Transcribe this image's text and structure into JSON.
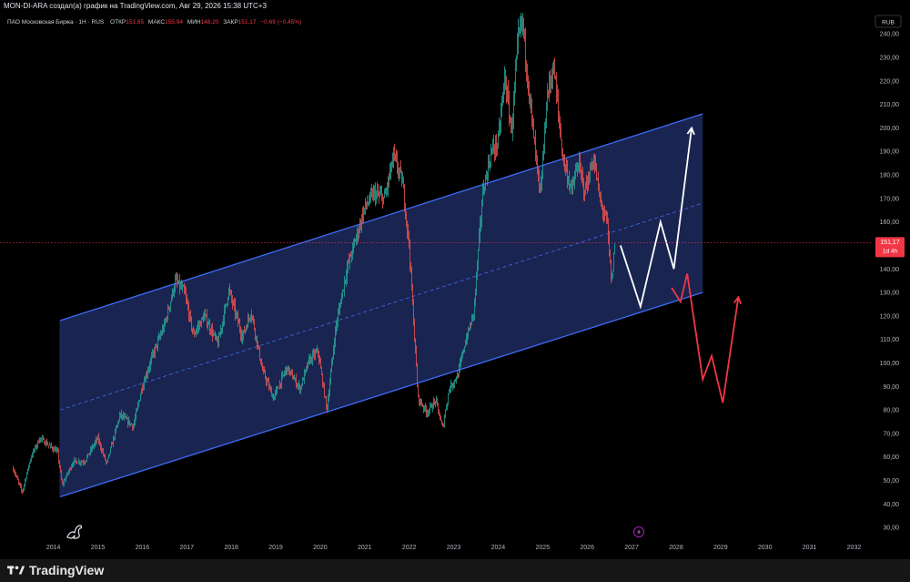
{
  "header": {
    "attribution": "MON-DI-ARA создал(а) график на TradingView.com, Авг 29, 2026 15:38 UTC+3"
  },
  "legend": {
    "symbol": "ПАО Московская Биржа · 1Н · RUS",
    "open_label": "ОТКР",
    "open_value": "151,85",
    "high_label": "МАКС",
    "high_value": "155,94",
    "low_label": "МИН",
    "low_value": "148,20",
    "close_label": "ЗАКР",
    "close_value": "151,17",
    "change": "−0,69 (−0,45%)"
  },
  "currency": "RUB",
  "price_label": {
    "value": "151,17",
    "countdown": "1d 4h"
  },
  "footer": {
    "brand": "TradingView"
  },
  "colors": {
    "background": "#000000",
    "channel_fill": "#1e2a5e",
    "channel_line": "#3d6cf7",
    "up_candle": "#26a69a",
    "down_candle": "#ef5350",
    "projection_white": "#ffffff",
    "projection_red": "#f23645",
    "price_line": "#f23645"
  },
  "chart_data": {
    "type": "candlestick",
    "y_axis": {
      "ticks": [
        30,
        40,
        50,
        60,
        70,
        80,
        90,
        100,
        110,
        120,
        130,
        140,
        150,
        160,
        170,
        180,
        190,
        200,
        210,
        220,
        230,
        240
      ],
      "tick_labels": [
        "30,00",
        "40,00",
        "50,00",
        "60,00",
        "70,00",
        "80,00",
        "90,00",
        "100,00",
        "110,00",
        "120,00",
        "130,00",
        "140,00",
        "150,00",
        "160,00",
        "170,00",
        "180,00",
        "190,00",
        "200,00",
        "210,00",
        "220,00",
        "230,00",
        "240,00"
      ],
      "range": [
        25,
        249
      ]
    },
    "x_axis": {
      "ticks": [
        2014,
        2015,
        2016,
        2017,
        2018,
        2019,
        2020,
        2021,
        2022,
        2023,
        2024,
        2025,
        2026,
        2027,
        2028,
        2029,
        2030,
        2031,
        2032
      ],
      "tick_labels": [
        "2014",
        "2015",
        "2016",
        "2017",
        "2018",
        "2019",
        "2020",
        "2021",
        "2022",
        "2023",
        "2024",
        "2025",
        "2026",
        "2027",
        "2028",
        "2029",
        "2030",
        "2031",
        "2032"
      ],
      "range": [
        2012.8,
        2032.4
      ]
    },
    "price_path": [
      [
        2013.1,
        55
      ],
      [
        2013.3,
        45
      ],
      [
        2013.5,
        60
      ],
      [
        2013.7,
        68
      ],
      [
        2013.9,
        65
      ],
      [
        2014.1,
        62
      ],
      [
        2014.2,
        48
      ],
      [
        2014.45,
        58
      ],
      [
        2014.7,
        58
      ],
      [
        2015.0,
        68
      ],
      [
        2015.2,
        57
      ],
      [
        2015.5,
        78
      ],
      [
        2015.8,
        73
      ],
      [
        2016.0,
        90
      ],
      [
        2016.25,
        104
      ],
      [
        2016.5,
        116
      ],
      [
        2016.75,
        135
      ],
      [
        2016.95,
        130
      ],
      [
        2017.15,
        112
      ],
      [
        2017.4,
        120
      ],
      [
        2017.7,
        108
      ],
      [
        2017.95,
        131
      ],
      [
        2018.25,
        111
      ],
      [
        2018.45,
        122
      ],
      [
        2018.7,
        97
      ],
      [
        2018.95,
        85
      ],
      [
        2019.25,
        98
      ],
      [
        2019.55,
        89
      ],
      [
        2019.75,
        101
      ],
      [
        2019.95,
        105
      ],
      [
        2020.15,
        80
      ],
      [
        2020.35,
        115
      ],
      [
        2020.6,
        140
      ],
      [
        2020.85,
        156
      ],
      [
        2021.0,
        166
      ],
      [
        2021.2,
        172
      ],
      [
        2021.45,
        170
      ],
      [
        2021.65,
        188
      ],
      [
        2021.85,
        177
      ],
      [
        2022.0,
        150
      ],
      [
        2022.1,
        118
      ],
      [
        2022.2,
        85
      ],
      [
        2022.4,
        79
      ],
      [
        2022.6,
        84
      ],
      [
        2022.75,
        72
      ],
      [
        2022.9,
        89
      ],
      [
        2023.1,
        95
      ],
      [
        2023.25,
        108
      ],
      [
        2023.45,
        121
      ],
      [
        2023.65,
        172
      ],
      [
        2023.85,
        190
      ],
      [
        2024.0,
        194
      ],
      [
        2024.15,
        222
      ],
      [
        2024.3,
        198
      ],
      [
        2024.45,
        238
      ],
      [
        2024.55,
        246
      ],
      [
        2024.65,
        224
      ],
      [
        2024.8,
        196
      ],
      [
        2024.95,
        170
      ],
      [
        2025.1,
        214
      ],
      [
        2025.25,
        226
      ],
      [
        2025.45,
        188
      ],
      [
        2025.65,
        173
      ],
      [
        2025.8,
        185
      ],
      [
        2025.95,
        173
      ],
      [
        2026.15,
        187
      ],
      [
        2026.3,
        168
      ],
      [
        2026.45,
        160
      ],
      [
        2026.55,
        133
      ],
      [
        2026.62,
        151
      ]
    ],
    "last_price": 151.17,
    "channel": {
      "upper": [
        [
          2014.15,
          118
        ],
        [
          2028.6,
          206
        ]
      ],
      "middle": [
        [
          2014.15,
          80
        ],
        [
          2028.6,
          168
        ]
      ],
      "lower": [
        [
          2014.15,
          43
        ],
        [
          2028.6,
          130
        ]
      ]
    },
    "projections": [
      {
        "color": "white",
        "points": [
          [
            2026.75,
            150
          ],
          [
            2027.2,
            124
          ],
          [
            2027.65,
            160
          ],
          [
            2027.95,
            140
          ],
          [
            2028.35,
            200
          ]
        ]
      },
      {
        "color": "red",
        "points": [
          [
            2027.9,
            132
          ],
          [
            2028.1,
            126
          ],
          [
            2028.25,
            138
          ],
          [
            2028.6,
            93
          ],
          [
            2028.8,
            103
          ],
          [
            2029.05,
            83
          ],
          [
            2029.4,
            128
          ]
        ]
      }
    ]
  }
}
